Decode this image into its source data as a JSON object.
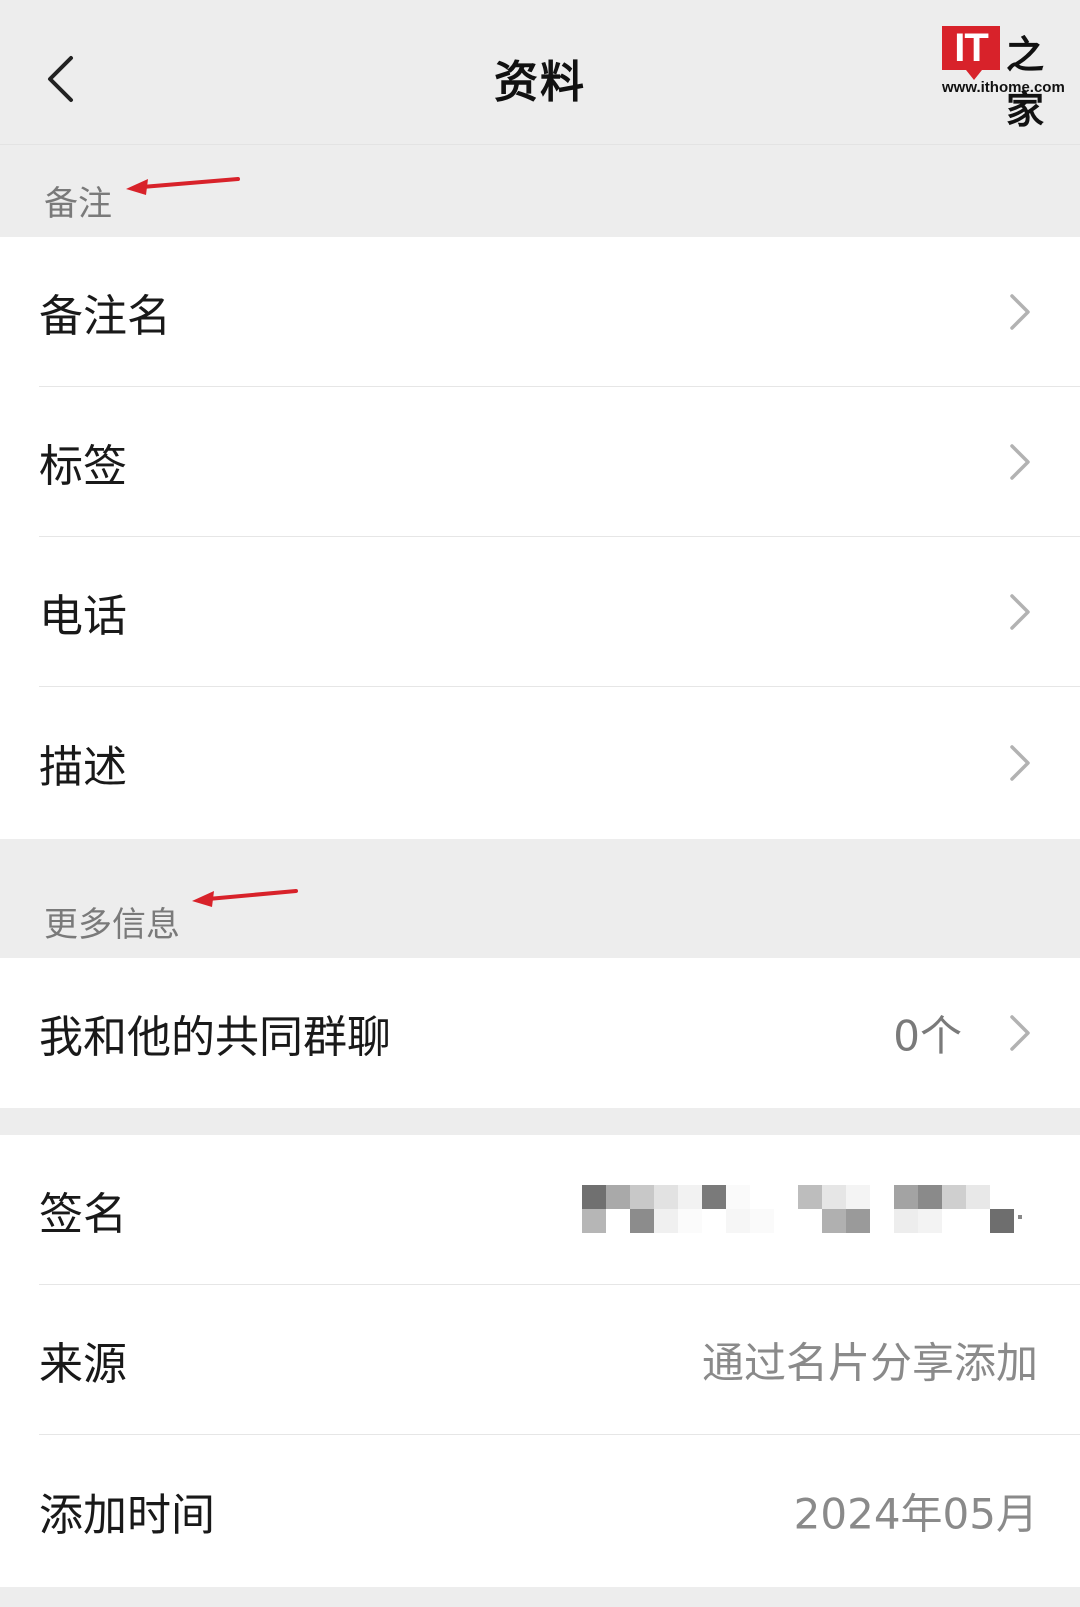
{
  "header": {
    "title": "资料",
    "logo_text": "IT之家",
    "logo_url": "www.ithome.com"
  },
  "sections": {
    "notes_label": "备注",
    "more_info_label": "更多信息"
  },
  "notes_rows": [
    {
      "label": "备注名"
    },
    {
      "label": "标签"
    },
    {
      "label": "电话"
    },
    {
      "label": "描述"
    }
  ],
  "common_groups": {
    "label": "我和他的共同群聊",
    "value": "0个"
  },
  "info_rows": [
    {
      "label": "签名",
      "value": ""
    },
    {
      "label": "来源",
      "value": "通过名片分享添加"
    },
    {
      "label": "添加时间",
      "value": "2024年05月"
    }
  ],
  "colors": {
    "accent_arrow": "#d8222a",
    "logo_red": "#d8222a"
  },
  "icons": {
    "back": "chevron-left-icon",
    "row_arrow": "chevron-right-icon",
    "annotation": "red-arrow-icon"
  }
}
